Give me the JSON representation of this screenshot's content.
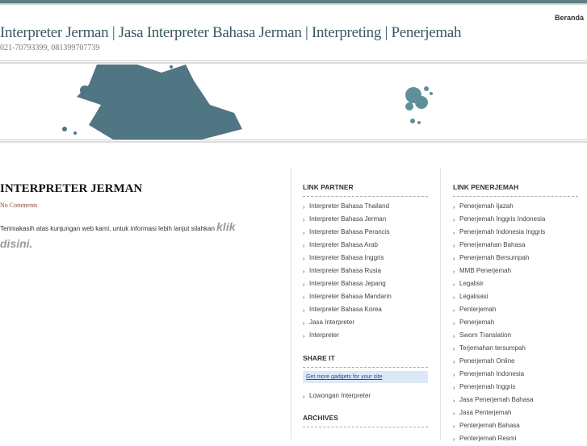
{
  "header": {
    "nav_home": "Beranda",
    "title": "Interpreter Jerman | Jasa Interpreter Bahasa Jerman | Interpreting | Penerjemah",
    "tagline": "021-70793399, 081399707739"
  },
  "post": {
    "title": "INTERPRETER JERMAN",
    "comments": "No Comments",
    "body": "Terimakasih atas kunjungan web kami, untuk informasi lebih lanjut silahkan ",
    "link": "klik disini."
  },
  "sidebar1": {
    "link_partner_title": "LINK PARTNER",
    "link_partner": [
      "Interpreter Bahasa Thailand",
      "Interpreter Bahasa Jerman",
      "Interpreter Bahasa Perancis",
      "Interpreter Bahasa Arab",
      "Interpreter Bahasa Inggris",
      "Interpreter Bahasa Rusia",
      "Interpreter Bahasa Jepang",
      "Interpreter Bahasa Mandarin",
      "Interpreter Bahasa Korea",
      "Jasa Interpreter",
      "Interpreter"
    ],
    "share_title": "SHARE IT",
    "gadget_link": "Get more gadgets for your site",
    "share_items": [
      "Lowongan Interpreter"
    ],
    "archives_title": "ARCHIVES"
  },
  "sidebar2": {
    "title": "LINK PENERJEMAH",
    "items": [
      "Penerjemah Ijazah",
      "Penerjemah Inggris Indonesia",
      "Penerjemah Indonesia Inggris",
      "Penerjemahan Bahasa",
      "Penerjemah Bersumpah",
      "MMB Penerjemah",
      "Legalisir",
      "Legalisasi",
      "Penterjemah",
      "Penerjemah",
      "Sworn Translation",
      "Terjemahan tersumpah",
      "Penerjemah Online",
      "Penerjemah Indonesia",
      "Penerjemah Inggris",
      "Jasa Penerjemah Bahasa",
      "Jasa Penterjemah",
      "Penterjemah Bahasa",
      "Penterjemah Resmi"
    ]
  },
  "colors": {
    "accent": "#5e7f86",
    "splash": "#4f7682"
  }
}
